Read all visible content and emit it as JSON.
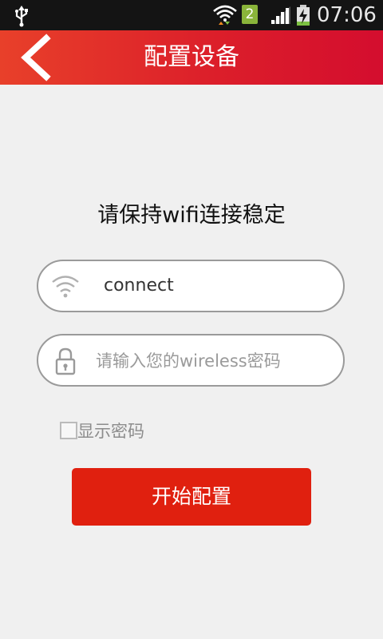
{
  "status_bar": {
    "sim_slot": "2",
    "time": "07:06"
  },
  "header": {
    "title": "配置设备"
  },
  "main": {
    "subtitle": "请保持wifi连接稳定",
    "ssid_value": "connect",
    "password_placeholder": "请输入您的wireless密码",
    "show_password_label": "显示密码",
    "start_button_label": "开始配置"
  },
  "colors": {
    "accent": "#e0200f",
    "header_gradient_start": "#e8402a",
    "header_gradient_end": "#d40d2e"
  },
  "icons": {
    "back": "chevron-left-icon",
    "ssid": "wifi-icon",
    "password": "lock-icon"
  }
}
